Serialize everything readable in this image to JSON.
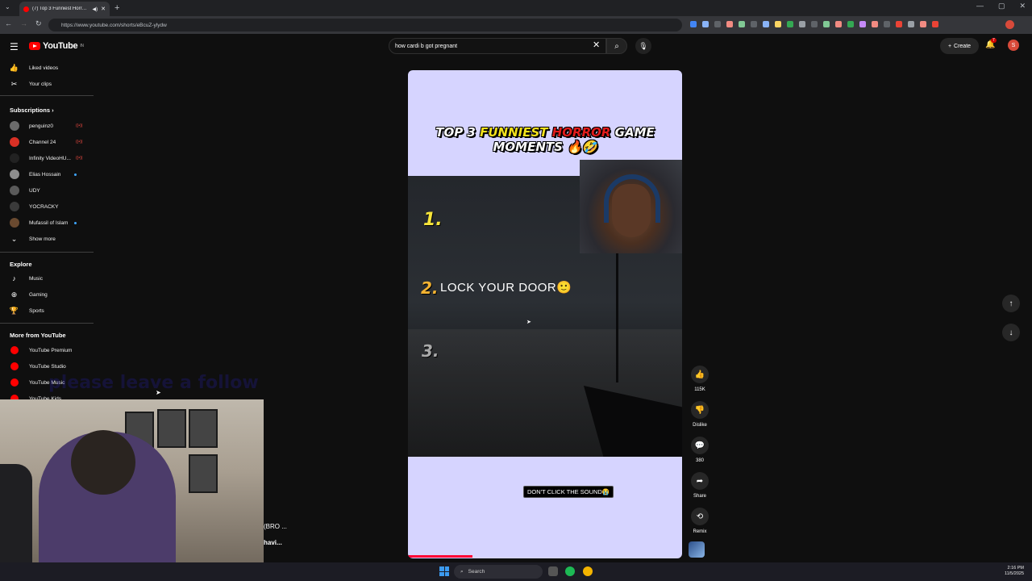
{
  "browser": {
    "tab_title": "(7) Top 3 Funniest Horror G...",
    "url": "https://www.youtube.com/shorts/eBcuZ-ylydw",
    "extension_colors": [
      "#4285f4",
      "#8ab4f8",
      "#5f6368",
      "#f28b82",
      "#81c995",
      "#5f6368",
      "#8ab4f8",
      "#fdd663",
      "#34a853",
      "#9aa0a6",
      "#5f6368",
      "#81c995",
      "#f28b82",
      "#34a853",
      "#c58af9",
      "#f28b82",
      "#5f6368",
      "#ea4335",
      "#9aa0a6",
      "#f28b82",
      "#ea4335"
    ]
  },
  "youtube": {
    "logo_text": "YouTube",
    "logo_badge": "IN",
    "search_query": "how cardi b got pregnant",
    "create_label": "Create",
    "notification_count": "7",
    "avatar_letter": "S"
  },
  "sidebar": {
    "top_items": [
      {
        "label": "Liked videos",
        "icon": "thumbs-up-icon"
      },
      {
        "label": "Your clips",
        "icon": "scissors-icon"
      }
    ],
    "subscriptions_heading": "Subscriptions",
    "subscriptions": [
      {
        "label": "penguinz0",
        "color": "#6b6b6b",
        "indicator": "live"
      },
      {
        "label": "Channel 24",
        "color": "#d93025",
        "indicator": "live"
      },
      {
        "label": "Infinity VideoHU...",
        "color": "#222222",
        "indicator": "live"
      },
      {
        "label": "Elias Hossain",
        "color": "#8e8e8e",
        "indicator": "dot"
      },
      {
        "label": "UDY",
        "color": "#5a5a5a",
        "indicator": ""
      },
      {
        "label": "YOCRACKY",
        "color": "#3a3a3a",
        "indicator": ""
      },
      {
        "label": "Mufassil of Islam",
        "color": "#6a4a30",
        "indicator": "dot"
      }
    ],
    "show_more": "Show more",
    "explore_heading": "Explore",
    "explore": [
      {
        "label": "Music",
        "icon": "music-note-icon"
      },
      {
        "label": "Gaming",
        "icon": "gamepad-icon"
      },
      {
        "label": "Sports",
        "icon": "trophy-icon"
      }
    ],
    "more_heading": "More from YouTube",
    "more": [
      {
        "label": "YouTube Premium"
      },
      {
        "label": "YouTube Studio"
      },
      {
        "label": "YouTube Music"
      },
      {
        "label": "YouTube Kids"
      }
    ]
  },
  "short": {
    "title_part1": "TOP 3 ",
    "title_part2": "FUNNIEST ",
    "title_part3": "HORROR",
    "title_part4": " GAME",
    "title_line2": "MOMENTS 🔥🤣",
    "rank1": "1.",
    "rank2": "2.",
    "rank2_text": "LOCK YOUR DOOR🙂",
    "rank3": "3.",
    "caption": "DON'T CLICK THE SOUND😭",
    "progress": 0.235
  },
  "actions": {
    "likes": "115K",
    "dislike": "Dislike",
    "comments": "380",
    "share": "Share",
    "remix": "Remix"
  },
  "overlay": {
    "text": "please leave a follow",
    "snip1": "(BRO ...",
    "snip2": "havi..."
  },
  "taskbar": {
    "search": "Search",
    "time": "2:16 PM",
    "date": "11/5/2025"
  }
}
